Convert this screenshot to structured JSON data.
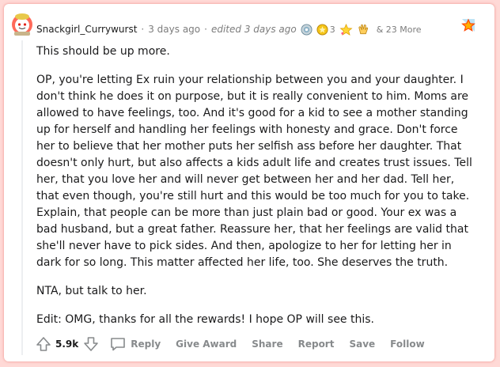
{
  "comment": {
    "username": "Snackgirl_Currywurst",
    "posted": "3 days ago",
    "edited": "edited 3 days ago",
    "awards": {
      "gold_count": "3",
      "more": "& 23 More"
    },
    "paragraphs": [
      "This should be up more.",
      "OP, you're letting Ex ruin your relationship between you and your daughter. I don't think he does it on purpose, but it is really convenient to him. Moms are allowed to have feelings, too. And it's good for a kid to see a mother standing up for herself and handling her feelings with honesty and grace. Don't force her to believe that her mother puts her selfish ass before her daughter. That doesn't only hurt, but also affects a kids adult life and creates trust issues. Tell her, that you love her and will never get between her and her dad. Tell her, that even though, you're still hurt and this would be too much for you to take. Explain, that people can be more than just plain bad or good. Your ex was a bad husband, but a great father. Reassure her, that her feelings are valid that she'll never have to pick sides. And then, apologize to her for letting her in dark for so long. This matter affected her life, too. She deserves the truth.",
      "NTA, but talk to her.",
      "Edit: OMG, thanks for all the rewards! I hope OP will see this."
    ],
    "score": "5.9k"
  },
  "actions": {
    "reply": "Reply",
    "give_award": "Give Award",
    "share": "Share",
    "report": "Report",
    "save": "Save",
    "follow": "Follow"
  },
  "colors": {
    "background": "#ffd9d6",
    "card": "#ffffff",
    "meta_text": "#7c7c7c",
    "action_text": "#878a8c",
    "body_text": "#1a1a1b"
  }
}
